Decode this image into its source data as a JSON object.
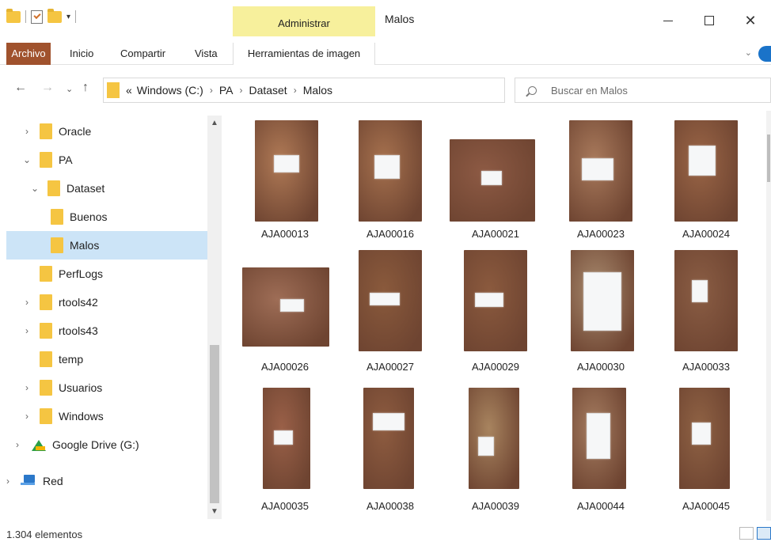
{
  "window": {
    "title": "Malos",
    "context_tab": "Administrar",
    "controls": {
      "minimize": "—",
      "maximize": "☐",
      "close": "✕"
    }
  },
  "ribbon": {
    "tabs": [
      "Archivo",
      "Inicio",
      "Compartir",
      "Vista",
      "Herramientas de imagen"
    ],
    "expand_icon": "chevron-down-icon",
    "help_icon": "help-icon"
  },
  "address": {
    "overflow": "«",
    "breadcrumbs": [
      "Windows (C:)",
      "PA",
      "Dataset",
      "Malos"
    ],
    "separator": "›"
  },
  "search": {
    "placeholder": "Buscar en Malos"
  },
  "nav_tree": [
    {
      "label": "Oracle",
      "expanded": false
    },
    {
      "label": "PA",
      "expanded": true
    },
    {
      "label": "Dataset",
      "expanded": true
    },
    {
      "label": "Buenos"
    },
    {
      "label": "Malos",
      "selected": true
    },
    {
      "label": "PerfLogs"
    },
    {
      "label": "rtools42",
      "expanded": false
    },
    {
      "label": "rtools43",
      "expanded": false
    },
    {
      "label": "temp"
    },
    {
      "label": "Usuarios",
      "expanded": false
    },
    {
      "label": "Windows",
      "expanded": false
    },
    {
      "label": "Google Drive (G:)",
      "expanded": false,
      "icon": "google-drive-icon"
    },
    {
      "label": "Red",
      "expanded": false,
      "icon": "network-icon"
    }
  ],
  "files": [
    {
      "name": "AJA00013"
    },
    {
      "name": "AJA00016"
    },
    {
      "name": "AJA00021"
    },
    {
      "name": "AJA00023"
    },
    {
      "name": "AJA00024"
    },
    {
      "name": "AJA00026"
    },
    {
      "name": "AJA00027"
    },
    {
      "name": "AJA00029"
    },
    {
      "name": "AJA00030"
    },
    {
      "name": "AJA00033"
    },
    {
      "name": "AJA00035"
    },
    {
      "name": "AJA00038"
    },
    {
      "name": "AJA00039"
    },
    {
      "name": "AJA00044"
    },
    {
      "name": "AJA00045"
    }
  ],
  "status": {
    "item_count": "1.304 elementos"
  },
  "colors": {
    "file_tab": "#a0522d",
    "context_tab": "#f7f09c",
    "selection": "#cce4f7",
    "folder": "#f5c542"
  }
}
